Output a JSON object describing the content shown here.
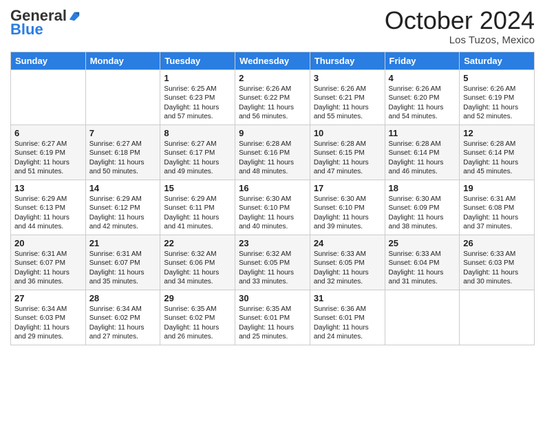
{
  "logo": {
    "general": "General",
    "blue": "Blue"
  },
  "header": {
    "month": "October 2024",
    "location": "Los Tuzos, Mexico"
  },
  "weekdays": [
    "Sunday",
    "Monday",
    "Tuesday",
    "Wednesday",
    "Thursday",
    "Friday",
    "Saturday"
  ],
  "weeks": [
    [
      {
        "day": "",
        "sunrise": "",
        "sunset": "",
        "daylight": ""
      },
      {
        "day": "",
        "sunrise": "",
        "sunset": "",
        "daylight": ""
      },
      {
        "day": "1",
        "sunrise": "Sunrise: 6:25 AM",
        "sunset": "Sunset: 6:23 PM",
        "daylight": "Daylight: 11 hours and 57 minutes."
      },
      {
        "day": "2",
        "sunrise": "Sunrise: 6:26 AM",
        "sunset": "Sunset: 6:22 PM",
        "daylight": "Daylight: 11 hours and 56 minutes."
      },
      {
        "day": "3",
        "sunrise": "Sunrise: 6:26 AM",
        "sunset": "Sunset: 6:21 PM",
        "daylight": "Daylight: 11 hours and 55 minutes."
      },
      {
        "day": "4",
        "sunrise": "Sunrise: 6:26 AM",
        "sunset": "Sunset: 6:20 PM",
        "daylight": "Daylight: 11 hours and 54 minutes."
      },
      {
        "day": "5",
        "sunrise": "Sunrise: 6:26 AM",
        "sunset": "Sunset: 6:19 PM",
        "daylight": "Daylight: 11 hours and 52 minutes."
      }
    ],
    [
      {
        "day": "6",
        "sunrise": "Sunrise: 6:27 AM",
        "sunset": "Sunset: 6:19 PM",
        "daylight": "Daylight: 11 hours and 51 minutes."
      },
      {
        "day": "7",
        "sunrise": "Sunrise: 6:27 AM",
        "sunset": "Sunset: 6:18 PM",
        "daylight": "Daylight: 11 hours and 50 minutes."
      },
      {
        "day": "8",
        "sunrise": "Sunrise: 6:27 AM",
        "sunset": "Sunset: 6:17 PM",
        "daylight": "Daylight: 11 hours and 49 minutes."
      },
      {
        "day": "9",
        "sunrise": "Sunrise: 6:28 AM",
        "sunset": "Sunset: 6:16 PM",
        "daylight": "Daylight: 11 hours and 48 minutes."
      },
      {
        "day": "10",
        "sunrise": "Sunrise: 6:28 AM",
        "sunset": "Sunset: 6:15 PM",
        "daylight": "Daylight: 11 hours and 47 minutes."
      },
      {
        "day": "11",
        "sunrise": "Sunrise: 6:28 AM",
        "sunset": "Sunset: 6:14 PM",
        "daylight": "Daylight: 11 hours and 46 minutes."
      },
      {
        "day": "12",
        "sunrise": "Sunrise: 6:28 AM",
        "sunset": "Sunset: 6:14 PM",
        "daylight": "Daylight: 11 hours and 45 minutes."
      }
    ],
    [
      {
        "day": "13",
        "sunrise": "Sunrise: 6:29 AM",
        "sunset": "Sunset: 6:13 PM",
        "daylight": "Daylight: 11 hours and 44 minutes."
      },
      {
        "day": "14",
        "sunrise": "Sunrise: 6:29 AM",
        "sunset": "Sunset: 6:12 PM",
        "daylight": "Daylight: 11 hours and 42 minutes."
      },
      {
        "day": "15",
        "sunrise": "Sunrise: 6:29 AM",
        "sunset": "Sunset: 6:11 PM",
        "daylight": "Daylight: 11 hours and 41 minutes."
      },
      {
        "day": "16",
        "sunrise": "Sunrise: 6:30 AM",
        "sunset": "Sunset: 6:10 PM",
        "daylight": "Daylight: 11 hours and 40 minutes."
      },
      {
        "day": "17",
        "sunrise": "Sunrise: 6:30 AM",
        "sunset": "Sunset: 6:10 PM",
        "daylight": "Daylight: 11 hours and 39 minutes."
      },
      {
        "day": "18",
        "sunrise": "Sunrise: 6:30 AM",
        "sunset": "Sunset: 6:09 PM",
        "daylight": "Daylight: 11 hours and 38 minutes."
      },
      {
        "day": "19",
        "sunrise": "Sunrise: 6:31 AM",
        "sunset": "Sunset: 6:08 PM",
        "daylight": "Daylight: 11 hours and 37 minutes."
      }
    ],
    [
      {
        "day": "20",
        "sunrise": "Sunrise: 6:31 AM",
        "sunset": "Sunset: 6:07 PM",
        "daylight": "Daylight: 11 hours and 36 minutes."
      },
      {
        "day": "21",
        "sunrise": "Sunrise: 6:31 AM",
        "sunset": "Sunset: 6:07 PM",
        "daylight": "Daylight: 11 hours and 35 minutes."
      },
      {
        "day": "22",
        "sunrise": "Sunrise: 6:32 AM",
        "sunset": "Sunset: 6:06 PM",
        "daylight": "Daylight: 11 hours and 34 minutes."
      },
      {
        "day": "23",
        "sunrise": "Sunrise: 6:32 AM",
        "sunset": "Sunset: 6:05 PM",
        "daylight": "Daylight: 11 hours and 33 minutes."
      },
      {
        "day": "24",
        "sunrise": "Sunrise: 6:33 AM",
        "sunset": "Sunset: 6:05 PM",
        "daylight": "Daylight: 11 hours and 32 minutes."
      },
      {
        "day": "25",
        "sunrise": "Sunrise: 6:33 AM",
        "sunset": "Sunset: 6:04 PM",
        "daylight": "Daylight: 11 hours and 31 minutes."
      },
      {
        "day": "26",
        "sunrise": "Sunrise: 6:33 AM",
        "sunset": "Sunset: 6:03 PM",
        "daylight": "Daylight: 11 hours and 30 minutes."
      }
    ],
    [
      {
        "day": "27",
        "sunrise": "Sunrise: 6:34 AM",
        "sunset": "Sunset: 6:03 PM",
        "daylight": "Daylight: 11 hours and 29 minutes."
      },
      {
        "day": "28",
        "sunrise": "Sunrise: 6:34 AM",
        "sunset": "Sunset: 6:02 PM",
        "daylight": "Daylight: 11 hours and 27 minutes."
      },
      {
        "day": "29",
        "sunrise": "Sunrise: 6:35 AM",
        "sunset": "Sunset: 6:02 PM",
        "daylight": "Daylight: 11 hours and 26 minutes."
      },
      {
        "day": "30",
        "sunrise": "Sunrise: 6:35 AM",
        "sunset": "Sunset: 6:01 PM",
        "daylight": "Daylight: 11 hours and 25 minutes."
      },
      {
        "day": "31",
        "sunrise": "Sunrise: 6:36 AM",
        "sunset": "Sunset: 6:01 PM",
        "daylight": "Daylight: 11 hours and 24 minutes."
      },
      {
        "day": "",
        "sunrise": "",
        "sunset": "",
        "daylight": ""
      },
      {
        "day": "",
        "sunrise": "",
        "sunset": "",
        "daylight": ""
      }
    ]
  ]
}
